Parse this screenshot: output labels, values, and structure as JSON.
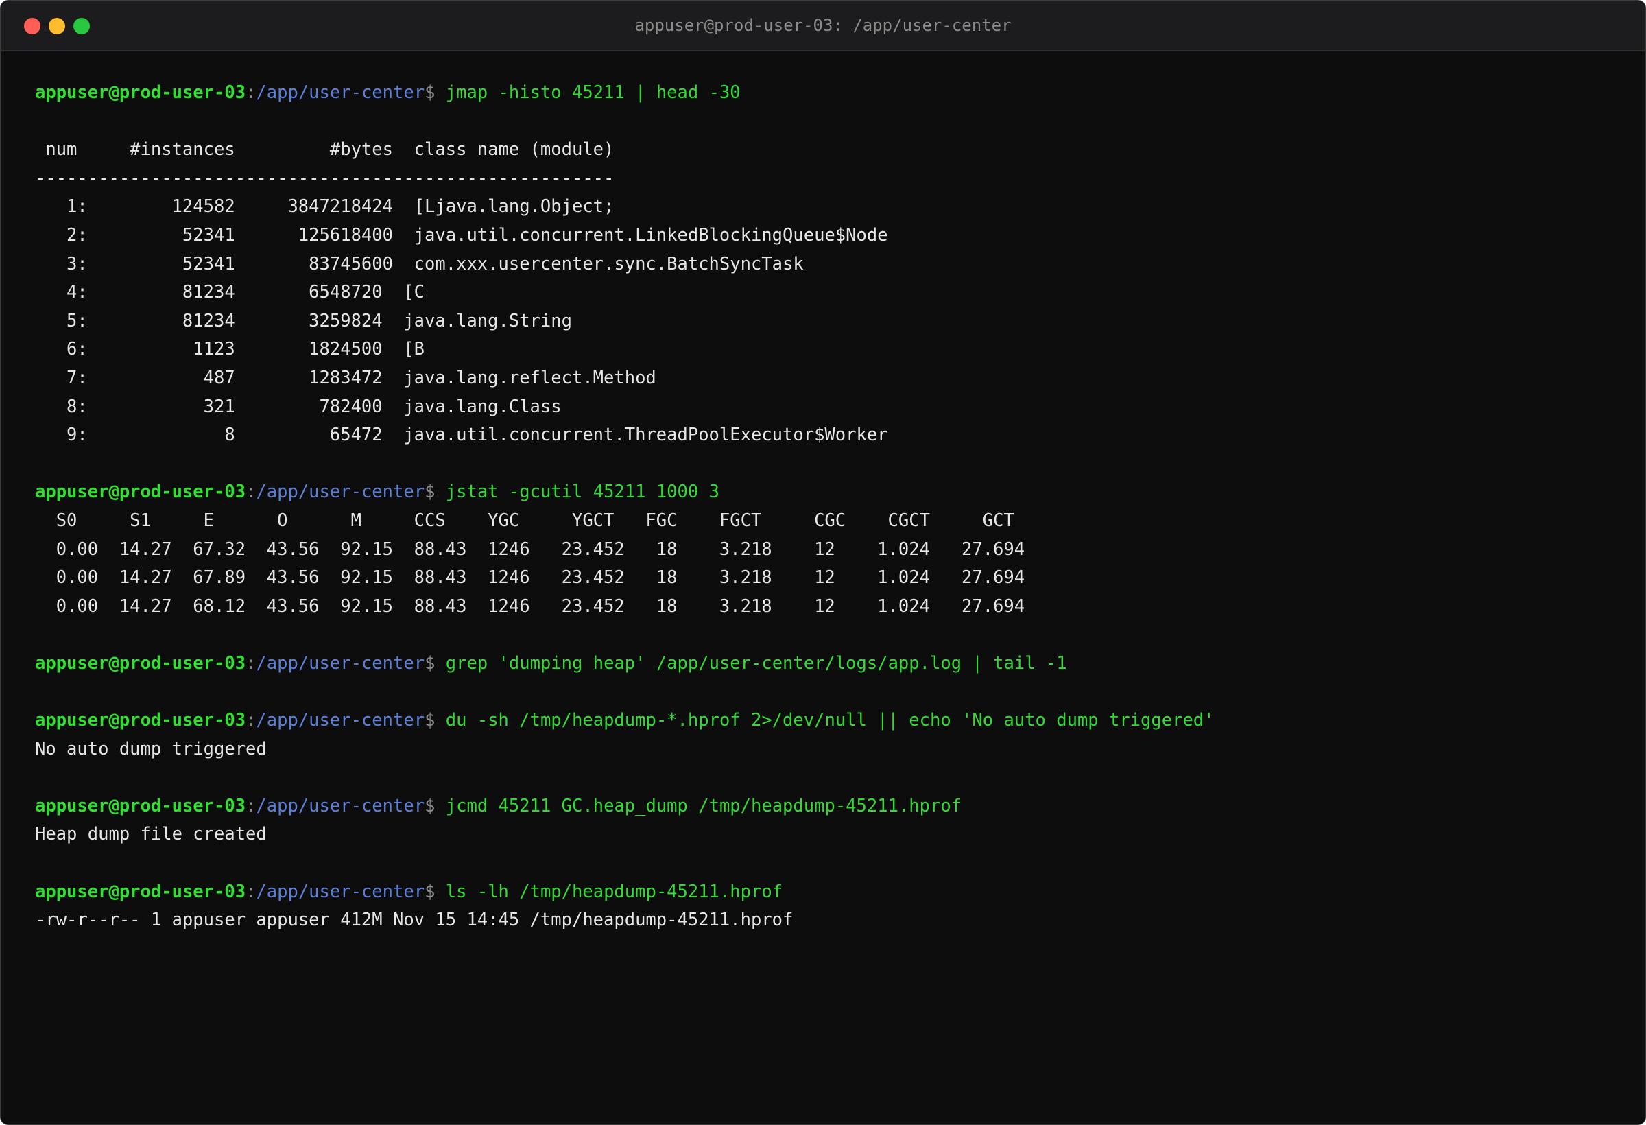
{
  "window": {
    "title": "appuser@prod-user-03: /app/user-center"
  },
  "prompt": {
    "user": "appuser",
    "at": "@",
    "host": "prod-user-03",
    "colon": ":",
    "path": "/app/user-center",
    "dollar": "$ "
  },
  "blocks": [
    {
      "command": "jmap -histo 45211 | head -30",
      "output": [
        "",
        " num     #instances         #bytes  class name (module)",
        "-------------------------------------------------------",
        "   1:        124582     3847218424  [Ljava.lang.Object;",
        "   2:         52341      125618400  java.util.concurrent.LinkedBlockingQueue$Node",
        "   3:         52341       83745600  com.xxx.usercenter.sync.BatchSyncTask",
        "   4:         81234       6548720  [C",
        "   5:         81234       3259824  java.lang.String",
        "   6:          1123       1824500  [B",
        "   7:           487       1283472  java.lang.reflect.Method",
        "   8:           321        782400  java.lang.Class",
        "   9:             8         65472  java.util.concurrent.ThreadPoolExecutor$Worker",
        ""
      ]
    },
    {
      "command": "jstat -gcutil 45211 1000 3",
      "output": [
        "  S0     S1     E      O      M     CCS    YGC     YGCT   FGC    FGCT     CGC    CGCT     GCT",
        "  0.00  14.27  67.32  43.56  92.15  88.43  1246   23.452   18    3.218    12    1.024   27.694",
        "  0.00  14.27  67.89  43.56  92.15  88.43  1246   23.452   18    3.218    12    1.024   27.694",
        "  0.00  14.27  68.12  43.56  92.15  88.43  1246   23.452   18    3.218    12    1.024   27.694",
        ""
      ]
    },
    {
      "command": "grep 'dumping heap' /app/user-center/logs/app.log | tail -1",
      "output": [
        ""
      ]
    },
    {
      "command": "du -sh /tmp/heapdump-*.hprof 2>/dev/null || echo 'No auto dump triggered'",
      "output": [
        "No auto dump triggered",
        ""
      ]
    },
    {
      "command": "jcmd 45211 GC.heap_dump /tmp/heapdump-45211.hprof",
      "output": [
        "Heap dump file created",
        ""
      ]
    },
    {
      "command": "ls -lh /tmp/heapdump-45211.hprof",
      "output": [
        "-rw-r--r-- 1 appuser appuser 412M Nov 15 14:45 /tmp/heapdump-45211.hprof"
      ]
    }
  ]
}
